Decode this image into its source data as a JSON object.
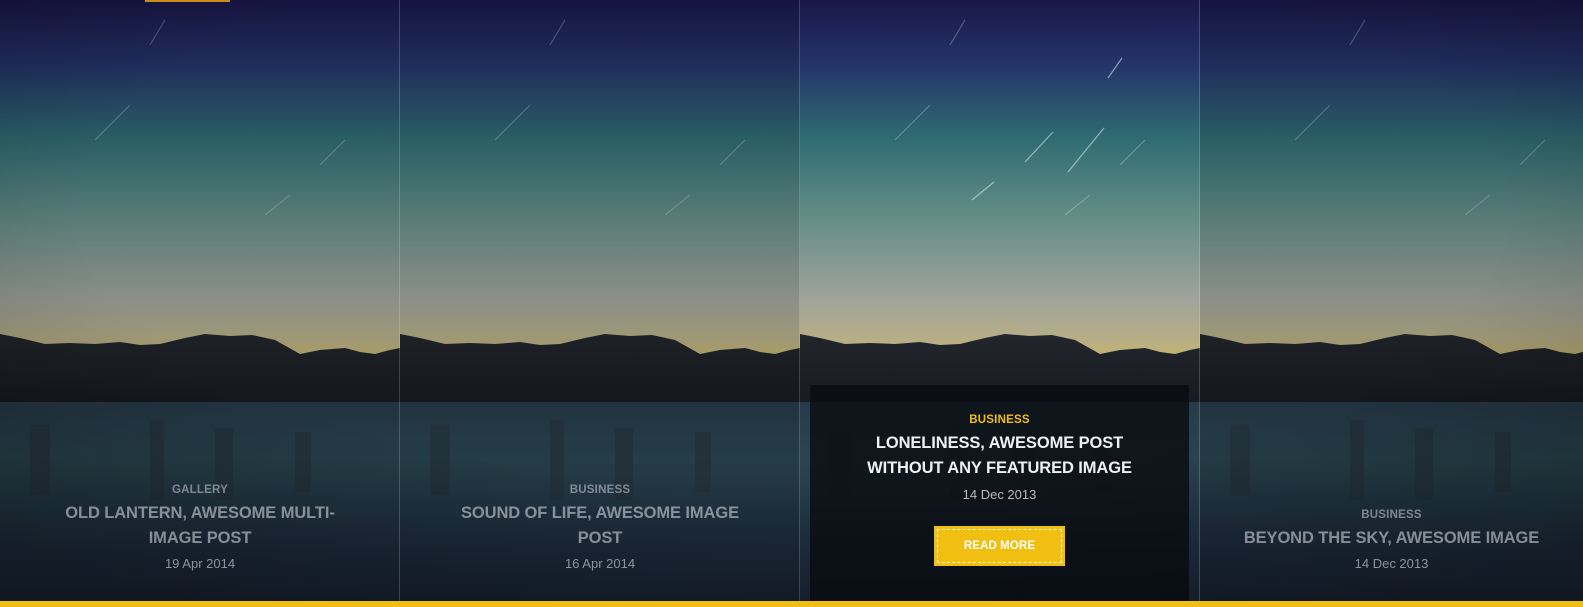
{
  "posts": [
    {
      "category": "GALLERY",
      "title": "OLD LANTERN, AWESOME MULTI-IMAGE POST",
      "date": "19 Apr 2014"
    },
    {
      "category": "BUSINESS",
      "title": "SOUND OF LIFE, AWESOME IMAGE POST",
      "date": "16 Apr 2014"
    },
    {
      "category": "BUSINESS",
      "title": "LONELINESS, AWESOME POST WITHOUT ANY FEATURED IMAGE",
      "date": "14 Dec 2013",
      "read_more": "READ MORE"
    },
    {
      "category": "BUSINESS",
      "title": "BEYOND THE SKY, AWESOME IMAGE",
      "date": "14 Dec 2013"
    }
  ],
  "colors": {
    "accent": "#f1bf11",
    "sky_top": "#1b1a52",
    "sky_mid": "#3a7a78",
    "horizon": "#a8aaa0",
    "water": "#1d2d3d"
  }
}
